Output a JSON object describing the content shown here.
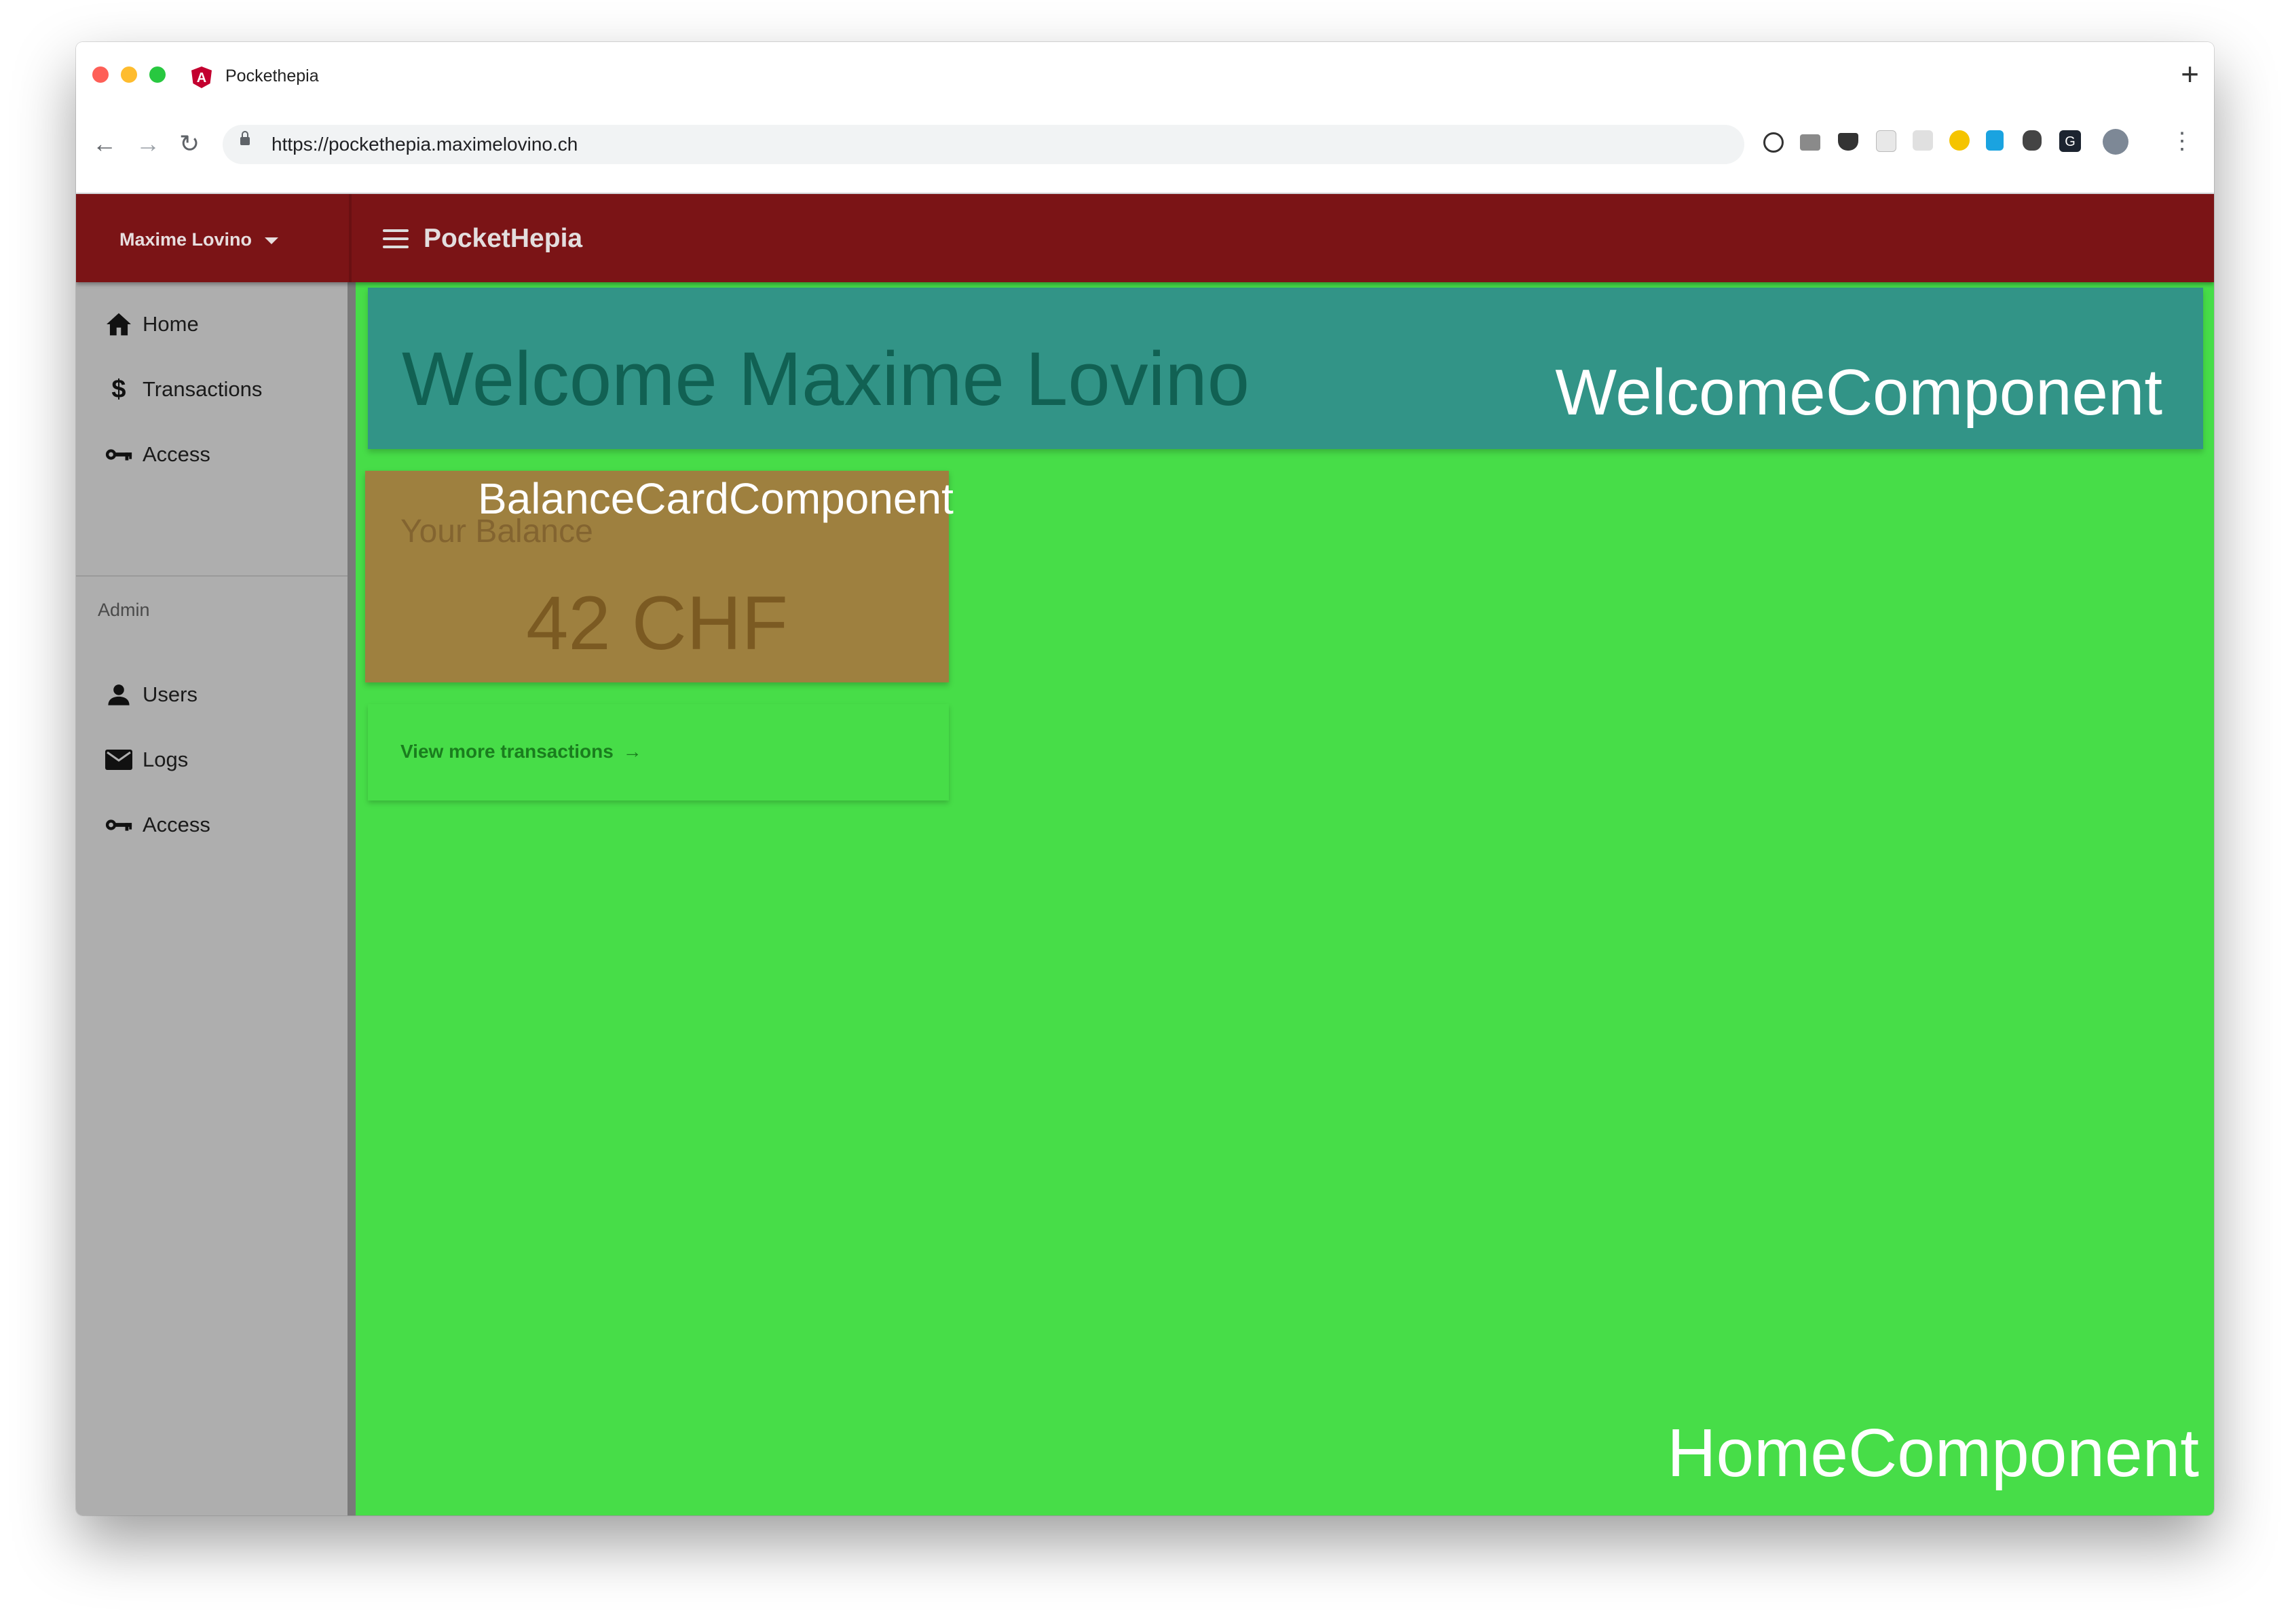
{
  "browser": {
    "tab_title": "Pockethepia",
    "favicon_letter": "A",
    "new_tab": "+",
    "url": "https://pockethepia.maximelovino.ch",
    "back": "←",
    "forward": "→",
    "reload": "↻",
    "menu": "⋮"
  },
  "toolbar": {
    "user_name": "Maxime Lovino",
    "app_title": "PocketHepia",
    "color": "#7b1416"
  },
  "sidebar": {
    "items": [
      {
        "label": "Home",
        "icon": "home-icon"
      },
      {
        "label": "Transactions",
        "icon": "dollar-icon"
      },
      {
        "label": "Access",
        "icon": "key-icon"
      }
    ],
    "admin_header": "Admin",
    "admin_items": [
      {
        "label": "Users",
        "icon": "person-icon"
      },
      {
        "label": "Logs",
        "icon": "mail-icon"
      },
      {
        "label": "Access",
        "icon": "key-icon"
      }
    ]
  },
  "welcome": {
    "title": "Welcome Maxime Lovino",
    "component_label": "WelcomeComponent",
    "color": "#329487"
  },
  "balance": {
    "subtitle": "Your Balance",
    "amount": "42 CHF",
    "component_label": "BalanceCardComponent",
    "color": "#9e803f"
  },
  "actions": {
    "view_more": "View more transactions",
    "arrow": "→"
  },
  "home": {
    "component_label": "HomeComponent",
    "color": "#47dd48"
  }
}
